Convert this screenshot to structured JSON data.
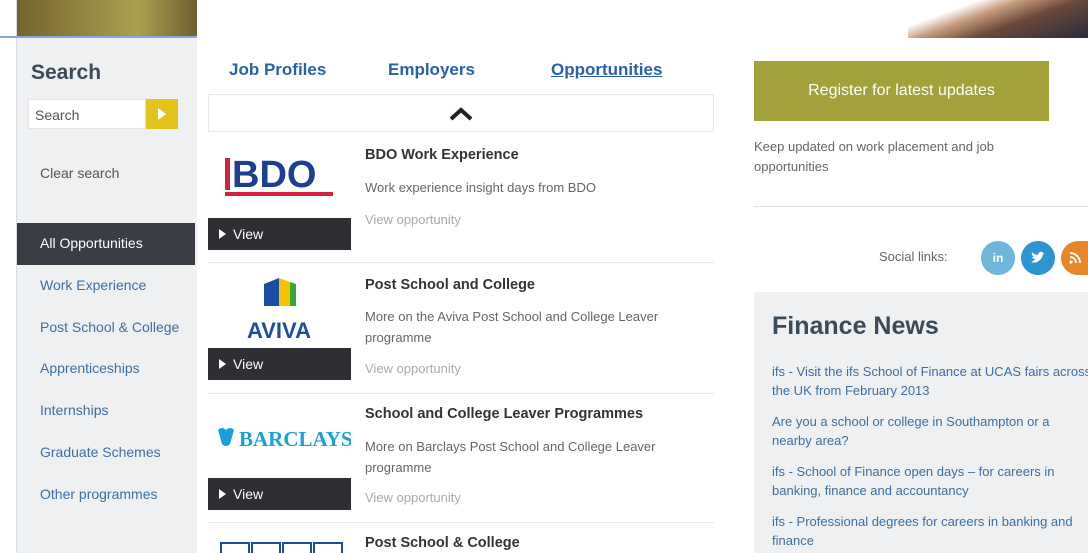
{
  "sidebar": {
    "title": "Search",
    "search_value": "Search",
    "clear_label": "Clear search",
    "categories": [
      {
        "label": "All Opportunities",
        "active": true
      },
      {
        "label": "Work Experience",
        "active": false
      },
      {
        "label": "Post School & College",
        "active": false
      },
      {
        "label": "Apprenticeships",
        "active": false
      },
      {
        "label": "Internships",
        "active": false
      },
      {
        "label": "Graduate Schemes",
        "active": false
      },
      {
        "label": "Other programmes",
        "active": false
      }
    ]
  },
  "tabs": [
    {
      "label": "Job Profiles"
    },
    {
      "label": "Employers"
    },
    {
      "label": "Opportunities"
    }
  ],
  "opportunities": [
    {
      "logo": "BDO",
      "title": "BDO Work Experience",
      "description": "Work experience insight days from BDO",
      "link": "View opportunity",
      "view_label": "View"
    },
    {
      "logo": "AVIVA",
      "title": "Post School and College",
      "description": "More on the Aviva Post School and College Leaver programme",
      "link": "View opportunity",
      "view_label": "View"
    },
    {
      "logo": "BARCLAYS",
      "title": "School and College Leaver Programmes",
      "description": "More on Barclays Post School and College Leaver programme",
      "link": "View opportunity",
      "view_label": "View"
    },
    {
      "title": "Post School & College"
    }
  ],
  "right": {
    "register_label": "Register for latest updates",
    "keep_text": "Keep updated on work placement and job opportunities",
    "social_label": "Social links:",
    "social_icons": [
      "linkedin-icon",
      "twitter-icon",
      "rss-icon"
    ],
    "social_linkedin_text": "in",
    "news": {
      "title": "Finance News",
      "items": [
        "ifs - Visit the ifs School of Finance at UCAS fairs across the UK from February 2013",
        "Are you a school or college in Southampton or a nearby area?",
        "ifs - School of Finance open days – for careers in banking, finance and accountancy",
        "ifs - Professional degrees for careers in banking and finance"
      ]
    }
  },
  "colors": {
    "accent_yellow": "#e2c31c",
    "register_olive": "#a3a23a",
    "link_blue": "#2a62a8",
    "dark_nav": "#3a3d44"
  }
}
